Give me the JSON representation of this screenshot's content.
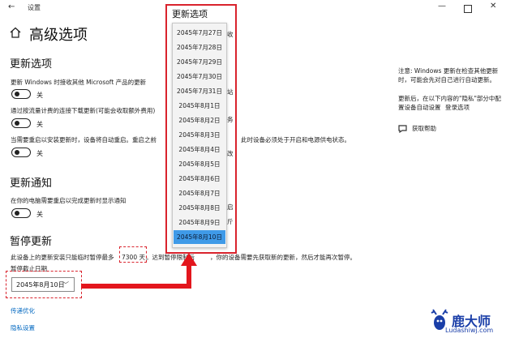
{
  "window": {
    "title": "设置"
  },
  "page": {
    "title": "高级选项"
  },
  "update_options": {
    "heading": "更新选项",
    "opt1_label": "更新 Windows 时接收其他 Microsoft 产品的更新",
    "opt1_state": "关",
    "opt2_label": "通过按流量计费的连接下载更新(可能会收取额外费用)",
    "opt2_state": "关",
    "opt3_label_left": "当需要重启以安装更新时，设备将自动重启。重启之前",
    "opt3_label_right": "此时设备必须处于开启和电源供电状态。",
    "opt3_state": "关"
  },
  "update_notify": {
    "heading": "更新通知",
    "label": "在你的电脑需要重启以完成更新时显示通知",
    "state": "关"
  },
  "pause": {
    "heading": "暂停更新",
    "desc_left": "此设备上的更新安装只能临时暂停最多",
    "days": "7300 天",
    "desc_mid": "。达到暂停限制后",
    "desc_right": "，你的设备需要先获取新的更新，然后才能再次暂停。",
    "date_label": "暂停截止日期",
    "selected_date": "2045年8月10日"
  },
  "links": {
    "delivery": "传递优化",
    "privacy": "隐私设置"
  },
  "dropdown": {
    "title": "更新选项",
    "items": [
      "2045年7月27日",
      "2045年7月28日",
      "2045年7月29日",
      "2045年7月30日",
      "2045年7月31日",
      "2045年8月1日",
      "2045年8月2日",
      "2045年8月3日",
      "2045年8月4日",
      "2045年8月5日",
      "2045年8月6日",
      "2045年8月7日",
      "2045年8月8日",
      "2045年8月9日",
      "2045年8月10日"
    ],
    "selected_index": 14,
    "peek": [
      "收",
      "站",
      "务",
      "改",
      "启",
      "斤"
    ]
  },
  "sidebar": {
    "note1_line1": "注意: Windows 更新在检查其他更新",
    "note1_line2": "时，可能会先对自己进行自动更新。",
    "note2_line1": "更新后，在以下内容的\"隐私\"部分中配",
    "note2_line2": "置设备自动设置",
    "note2_link": "登录选项",
    "help": "获取帮助"
  },
  "watermark": {
    "brand": "鹿大师",
    "url": "Ludashiwj.com"
  },
  "colors": {
    "annotation_red": "#e3161d",
    "selection_blue": "#3f9ae8",
    "link_blue": "#0067c0"
  }
}
